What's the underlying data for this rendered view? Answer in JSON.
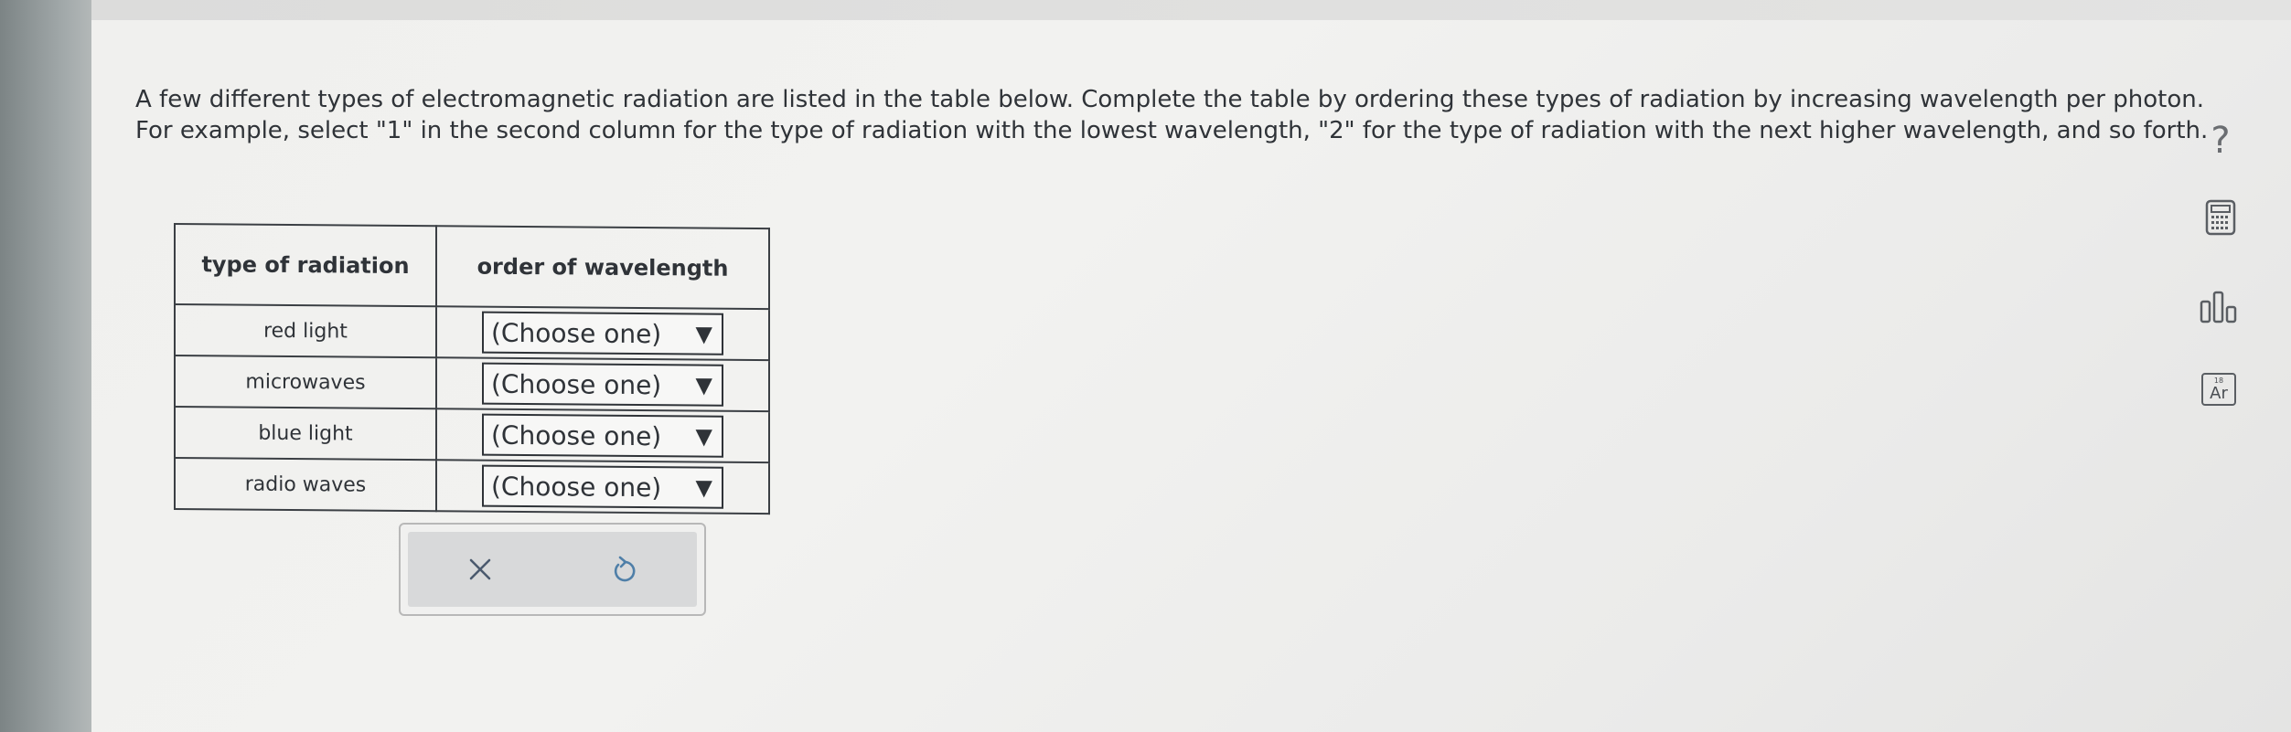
{
  "question": {
    "text": "A few different types of electromagnetic radiation are listed in the table below. Complete the table by ordering these types of radiation by increasing wavelength per photon. For example, select \"1\" in the second column for the type of radiation with the lowest wavelength, \"2\" for the type of radiation with the next higher wavelength, and so forth."
  },
  "table": {
    "headers": [
      "type of radiation",
      "order of wavelength"
    ],
    "rows": [
      {
        "type": "red light",
        "selection": "(Choose one)"
      },
      {
        "type": "microwaves",
        "selection": "(Choose one)"
      },
      {
        "type": "blue light",
        "selection": "(Choose one)"
      },
      {
        "type": "radio waves",
        "selection": "(Choose one)"
      }
    ],
    "dropdown_arrow": "▼"
  },
  "actions": {
    "clear_icon": "close-icon",
    "undo_icon": "undo-icon"
  },
  "side_tools": {
    "help_label": "?",
    "periodic_table_label": "Ar",
    "periodic_table_number": "18",
    "icons": [
      "help-icon",
      "calculator-icon",
      "bar-chart-icon",
      "periodic-table-icon"
    ]
  },
  "colors": {
    "text": "#2f3338",
    "border": "#3b3f44",
    "action_bg": "#d8d9da",
    "clear_icon": "#4b5a6e",
    "undo_icon": "#4f7fa8",
    "tool_icon": "#5a5e63"
  }
}
